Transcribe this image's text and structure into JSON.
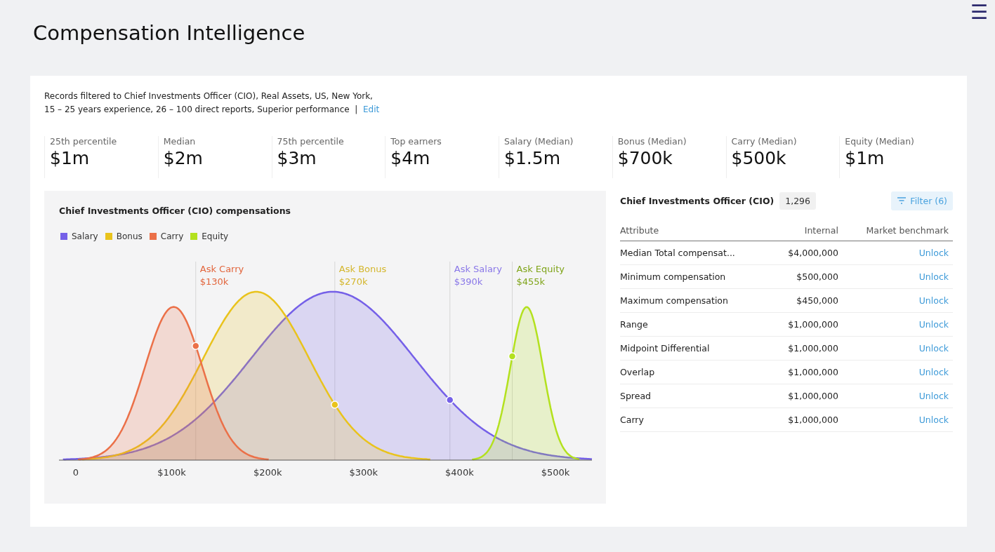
{
  "page_title": "Compensation Intelligence",
  "menu_icon": "☰",
  "filter_summary": {
    "lines": [
      "Records filtered to Chief Investments Officer (CIO), Real Assets, US, New York,",
      "15 – 25 years experience, 26 – 100 direct reports, Superior performance"
    ],
    "separator": "|",
    "link": "Edit"
  },
  "stats": [
    {
      "label": "25th percentile",
      "value": "$1m"
    },
    {
      "label": "Median",
      "value": "$2m"
    },
    {
      "label": "75th percentile",
      "value": "$3m"
    },
    {
      "label": "Top earners",
      "value": "$4m"
    },
    {
      "label": "Salary (Median)",
      "value": "$1.5m"
    },
    {
      "label": "Bonus (Median)",
      "value": "$700k"
    },
    {
      "label": "Carry (Median)",
      "value": "$500k"
    },
    {
      "label": "Equity (Median)",
      "value": "$1m"
    }
  ],
  "chart_panel": {
    "title": "Chief Investments Officer (CIO) compensations",
    "legend": [
      {
        "name": "Salary",
        "color": "#7560e8"
      },
      {
        "name": "Bonus",
        "color": "#e9c31c"
      },
      {
        "name": "Carry",
        "color": "#eb7048"
      },
      {
        "name": "Equity",
        "color": "#b3e11e"
      }
    ],
    "markers": [
      {
        "label": "Ask Carry",
        "value": "$130k",
        "color": "#e2653c"
      },
      {
        "label": "Ask Bonus",
        "value": "$270k",
        "color": "#d4b62c"
      },
      {
        "label": "Ask Salary",
        "value": "$390k",
        "color": "#8a78e8"
      },
      {
        "label": "Ask Equity",
        "value": "$455k",
        "color": "#7fa419"
      }
    ],
    "x_axis_labels": [
      "0",
      "$100k",
      "$200k",
      "$300k",
      "$400k",
      "$500k"
    ]
  },
  "table_panel": {
    "title": "Chief Investments Officer (CIO)",
    "count": "1,296",
    "filter_button": "Filter (6)",
    "columns": [
      "Attribute",
      "Internal",
      "Market benchmark"
    ],
    "rows": [
      {
        "attribute": "Median Total compensat...",
        "internal": "$4,000,000",
        "benchmark": "Unlock"
      },
      {
        "attribute": "Minimum compensation",
        "internal": "$500,000",
        "benchmark": "Unlock"
      },
      {
        "attribute": "Maximum compensation",
        "internal": "$450,000",
        "benchmark": "Unlock"
      },
      {
        "attribute": "Range",
        "internal": "$1,000,000",
        "benchmark": "Unlock"
      },
      {
        "attribute": "Midpoint Differential",
        "internal": "$1,000,000",
        "benchmark": "Unlock"
      },
      {
        "attribute": "Overlap",
        "internal": "$1,000,000",
        "benchmark": "Unlock"
      },
      {
        "attribute": "Spread",
        "internal": "$1,000,000",
        "benchmark": "Unlock"
      },
      {
        "attribute": "Carry",
        "internal": "$1,000,000",
        "benchmark": "Unlock"
      }
    ]
  }
}
